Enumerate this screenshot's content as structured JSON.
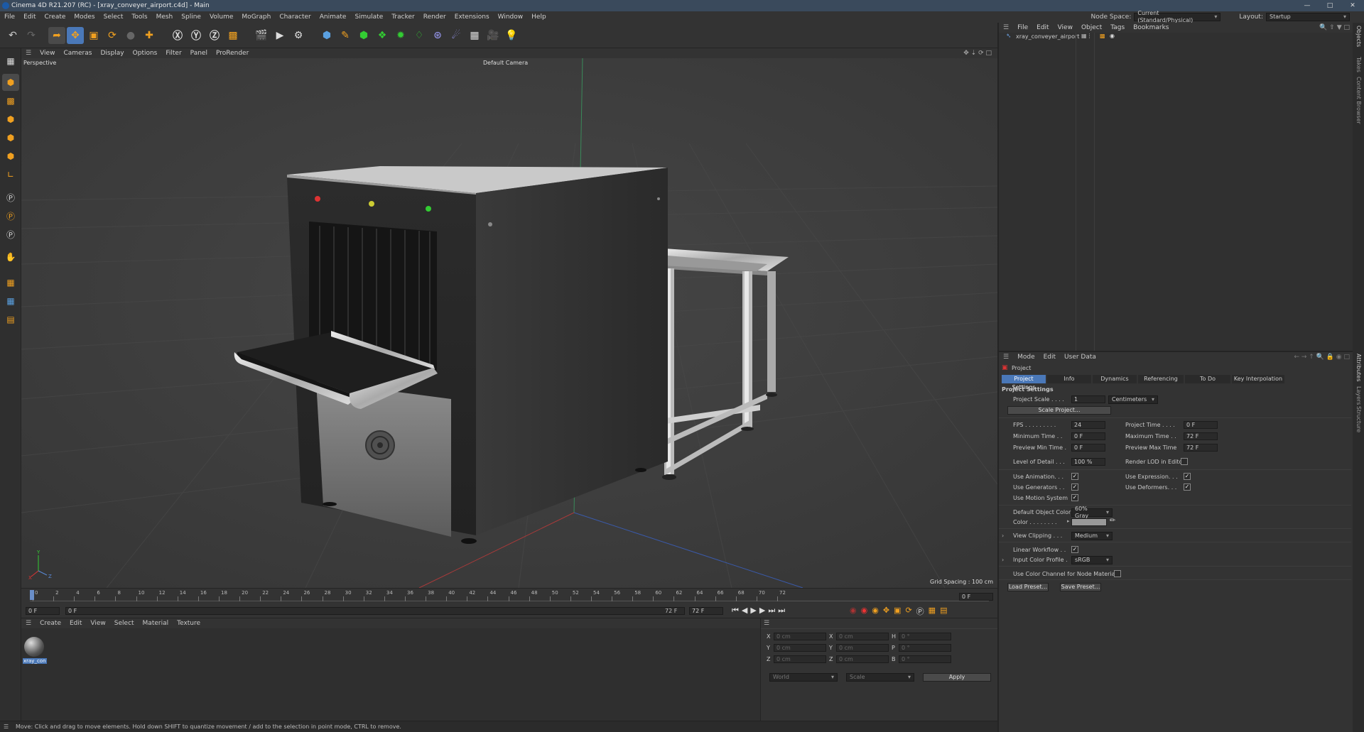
{
  "title": "Cinema 4D R21.207 (RC) - [xray_conveyer_airport.c4d] - Main",
  "menu": [
    "File",
    "Edit",
    "Create",
    "Modes",
    "Select",
    "Tools",
    "Mesh",
    "Spline",
    "Volume",
    "MoGraph",
    "Character",
    "Animate",
    "Simulate",
    "Tracker",
    "Render",
    "Extensions",
    "Window",
    "Help"
  ],
  "node_space_label": "Node Space:",
  "node_space_value": "Current (Standard/Physical)",
  "layout_label": "Layout:",
  "layout_value": "Startup",
  "viewport": {
    "menu": [
      "View",
      "Cameras",
      "Display",
      "Options",
      "Filter",
      "Panel",
      "ProRender"
    ],
    "perspective": "Perspective",
    "camera": "Default Camera",
    "grid_spacing": "Grid Spacing : 100 cm",
    "axis_x": "X",
    "axis_y": "Y",
    "axis_z": "Z"
  },
  "timeline": {
    "ticks": [
      "0",
      "2",
      "4",
      "6",
      "8",
      "10",
      "12",
      "14",
      "16",
      "18",
      "20",
      "22",
      "24",
      "26",
      "28",
      "30",
      "32",
      "34",
      "36",
      "38",
      "40",
      "42",
      "44",
      "46",
      "48",
      "50",
      "52",
      "54",
      "56",
      "58",
      "60",
      "62",
      "64",
      "66",
      "68",
      "70",
      "72"
    ],
    "current_frame": "0 F",
    "start": "0 F",
    "min": "0 F",
    "end": "72 F",
    "max": "72 F",
    "frame_right": "0 F"
  },
  "material": {
    "menu": [
      "Create",
      "Edit",
      "View",
      "Select",
      "Material",
      "Texture"
    ],
    "item_label": "xray_con"
  },
  "coords": {
    "rows": [
      {
        "a": "X",
        "av": "0 cm",
        "b": "X",
        "bv": "0 cm",
        "c": "H",
        "cv": "0 °"
      },
      {
        "a": "Y",
        "av": "0 cm",
        "b": "Y",
        "bv": "0 cm",
        "c": "P",
        "cv": "0 °"
      },
      {
        "a": "Z",
        "av": "0 cm",
        "b": "Z",
        "bv": "0 cm",
        "c": "B",
        "cv": "0 °"
      }
    ],
    "world": "World",
    "scale": "Scale",
    "apply": "Apply"
  },
  "objects": {
    "menu": [
      "File",
      "Edit",
      "View",
      "Object",
      "Tags",
      "Bookmarks"
    ],
    "item": "xray_conveyer_airport"
  },
  "right_strip": [
    "Objects",
    "Takes",
    "Content Browser",
    "Attributes",
    "Layers",
    "Structure"
  ],
  "attributes": {
    "menu": [
      "Mode",
      "Edit",
      "User Data"
    ],
    "object": "Project",
    "tabs": [
      "Project Settings",
      "Info",
      "Dynamics",
      "Referencing",
      "To Do",
      "Key Interpolation"
    ],
    "section": "Project Settings",
    "project_scale_label": "Project Scale . . . .",
    "project_scale_value": "1",
    "project_scale_unit": "Centimeters",
    "scale_project_btn": "Scale Project...",
    "fps_label": "FPS . . . . . . . . .",
    "fps_value": "24",
    "project_time_label": "Project Time . . . .",
    "project_time_value": "0 F",
    "min_time_label": "Minimum Time . .",
    "min_time_value": "0 F",
    "max_time_label": "Maximum Time . .",
    "max_time_value": "72 F",
    "prev_min_label": "Preview Min Time .",
    "prev_min_value": "0 F",
    "prev_max_label": "Preview Max Time",
    "prev_max_value": "72 F",
    "lod_label": "Level of Detail . . .",
    "lod_value": "100 %",
    "render_lod_label": "Render LOD in Editor",
    "use_animation": "Use Animation. . .",
    "use_expression": "Use Expression. . .",
    "use_generators": "Use Generators . .",
    "use_deformers": "Use Deformers. . .",
    "use_motion": "Use Motion System",
    "default_color_label": "Default Object Color",
    "default_color_value": "60% Gray",
    "color_label": "Color . . . . . . . .",
    "view_clipping_label": "View Clipping . . .",
    "view_clipping_value": "Medium",
    "linear_workflow": "Linear Workflow . .",
    "input_color_label": "Input Color Profile .",
    "input_color_value": "sRGB",
    "use_color_channel": "Use Color Channel for Node Material",
    "load_preset": "Load Preset...",
    "save_preset": "Save Preset..."
  },
  "status": "Move: Click and drag to move elements. Hold down SHIFT to quantize movement / add to the selection in point mode, CTRL to remove.",
  "colors": {
    "accent": "#4a78b8",
    "tab_active": "#4a78b8",
    "led_red": "#d33",
    "led_yellow": "#cc3",
    "led_green": "#3c3"
  }
}
